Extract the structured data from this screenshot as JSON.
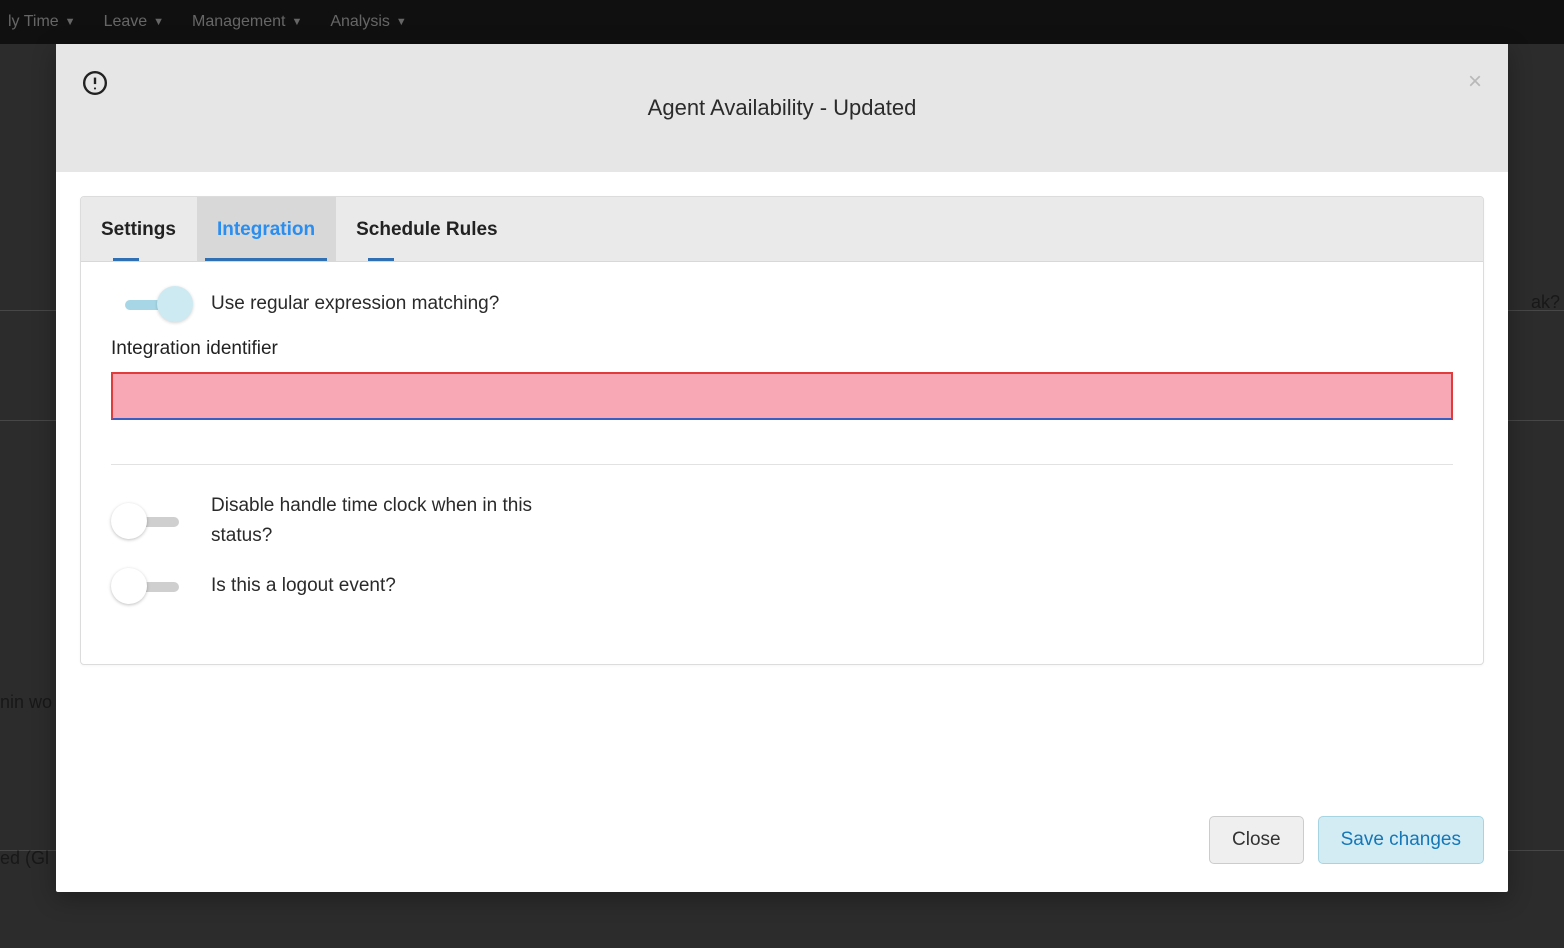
{
  "nav": {
    "items": [
      {
        "label": "ly Time"
      },
      {
        "label": "Leave"
      },
      {
        "label": "Management"
      },
      {
        "label": "Analysis"
      }
    ]
  },
  "background": {
    "text_right": "ak?",
    "text_left_1": "nin wo",
    "text_left_2": "ed (Gl"
  },
  "modal": {
    "title": "Agent Availability - Updated",
    "tabs": [
      {
        "label": "Settings",
        "active": false
      },
      {
        "label": "Integration",
        "active": true
      },
      {
        "label": "Schedule Rules",
        "active": false
      }
    ],
    "integration": {
      "regex_toggle_label": "Use regular expression matching?",
      "regex_toggle_on": true,
      "identifier_label": "Integration identifier",
      "identifier_value": "",
      "disable_clock_label": "Disable handle time clock when in this status?",
      "disable_clock_on": false,
      "logout_event_label": "Is this a logout event?",
      "logout_event_on": false
    },
    "footer": {
      "close_label": "Close",
      "save_label": "Save changes"
    }
  }
}
